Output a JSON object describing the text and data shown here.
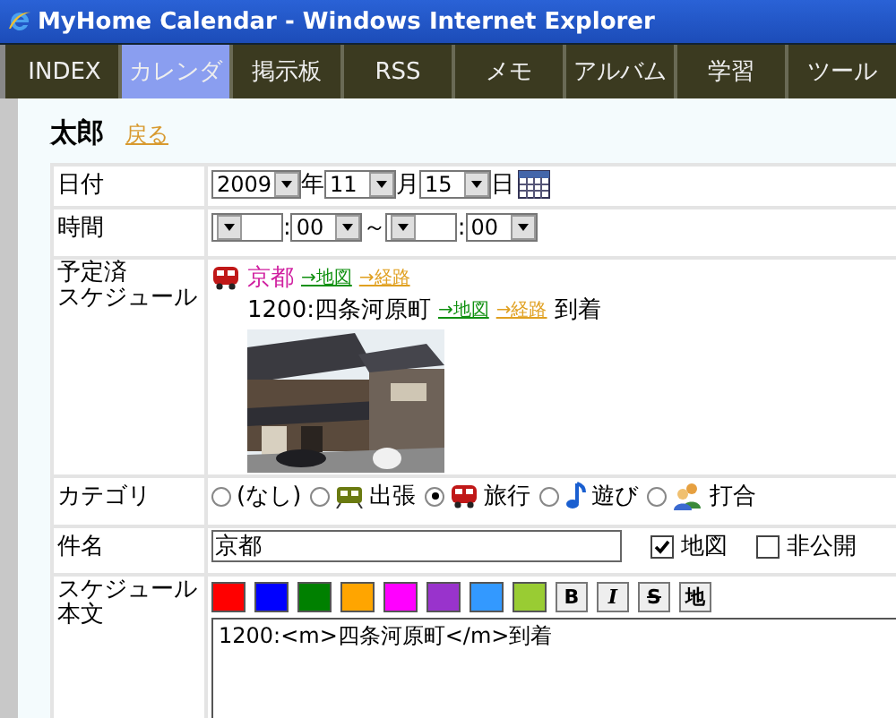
{
  "window": {
    "title": "MyHome Calendar - Windows Internet Explorer"
  },
  "tabs": [
    {
      "label": "INDEX",
      "selected": false
    },
    {
      "label": "カレンダ",
      "selected": true
    },
    {
      "label": "掲示板",
      "selected": false
    },
    {
      "label": "RSS",
      "selected": false
    },
    {
      "label": "メモ",
      "selected": false
    },
    {
      "label": "アルバム",
      "selected": false
    },
    {
      "label": "学習",
      "selected": false
    },
    {
      "label": "ツール",
      "selected": false
    }
  ],
  "user": {
    "name": "太郎",
    "back_link": "戻る"
  },
  "form": {
    "date": {
      "label": "日付",
      "year": "2009",
      "year_unit": "年",
      "month": "11",
      "month_unit": "月",
      "day": "15",
      "day_unit": "日"
    },
    "time": {
      "label": "時間",
      "start_colon": ":",
      "start_minute": "00",
      "to": "～",
      "end_colon": ":",
      "end_minute": "00"
    },
    "scheduled": {
      "label_lines": [
        "予定済",
        "スケジュール"
      ],
      "title": "京都",
      "links": [
        "→地図",
        "→経路"
      ],
      "entry": {
        "time_place": "1200:四条河原町",
        "links": [
          "→地図",
          "→経路"
        ],
        "note": "到着"
      }
    },
    "category": {
      "label": "カテゴリ",
      "options": [
        {
          "label": "(なし)",
          "kind": "none",
          "selected": false
        },
        {
          "label": "出張",
          "kind": "train",
          "selected": false
        },
        {
          "label": "旅行",
          "kind": "bus",
          "selected": true
        },
        {
          "label": "遊び",
          "kind": "music",
          "selected": false
        },
        {
          "label": "打合",
          "kind": "people",
          "selected": false
        }
      ]
    },
    "subject": {
      "label": "件名",
      "value": "京都",
      "checks": [
        {
          "label": "地図",
          "checked": true
        },
        {
          "label": "非公開",
          "checked": false
        }
      ]
    },
    "body": {
      "label_lines": [
        "スケジュール",
        "本文"
      ],
      "swatches": [
        {
          "color": "#ff0000"
        },
        {
          "color": "#0000ff"
        },
        {
          "color": "#008000"
        },
        {
          "color": "#ffa500"
        },
        {
          "color": "#ff00ff"
        },
        {
          "color": "#9933cc"
        },
        {
          "color": "#3399ff"
        },
        {
          "color": "#99cc33"
        }
      ],
      "tools": [
        "B",
        "I",
        "S",
        "地"
      ],
      "value": "1200:<m>四条河原町</m>到着"
    }
  }
}
